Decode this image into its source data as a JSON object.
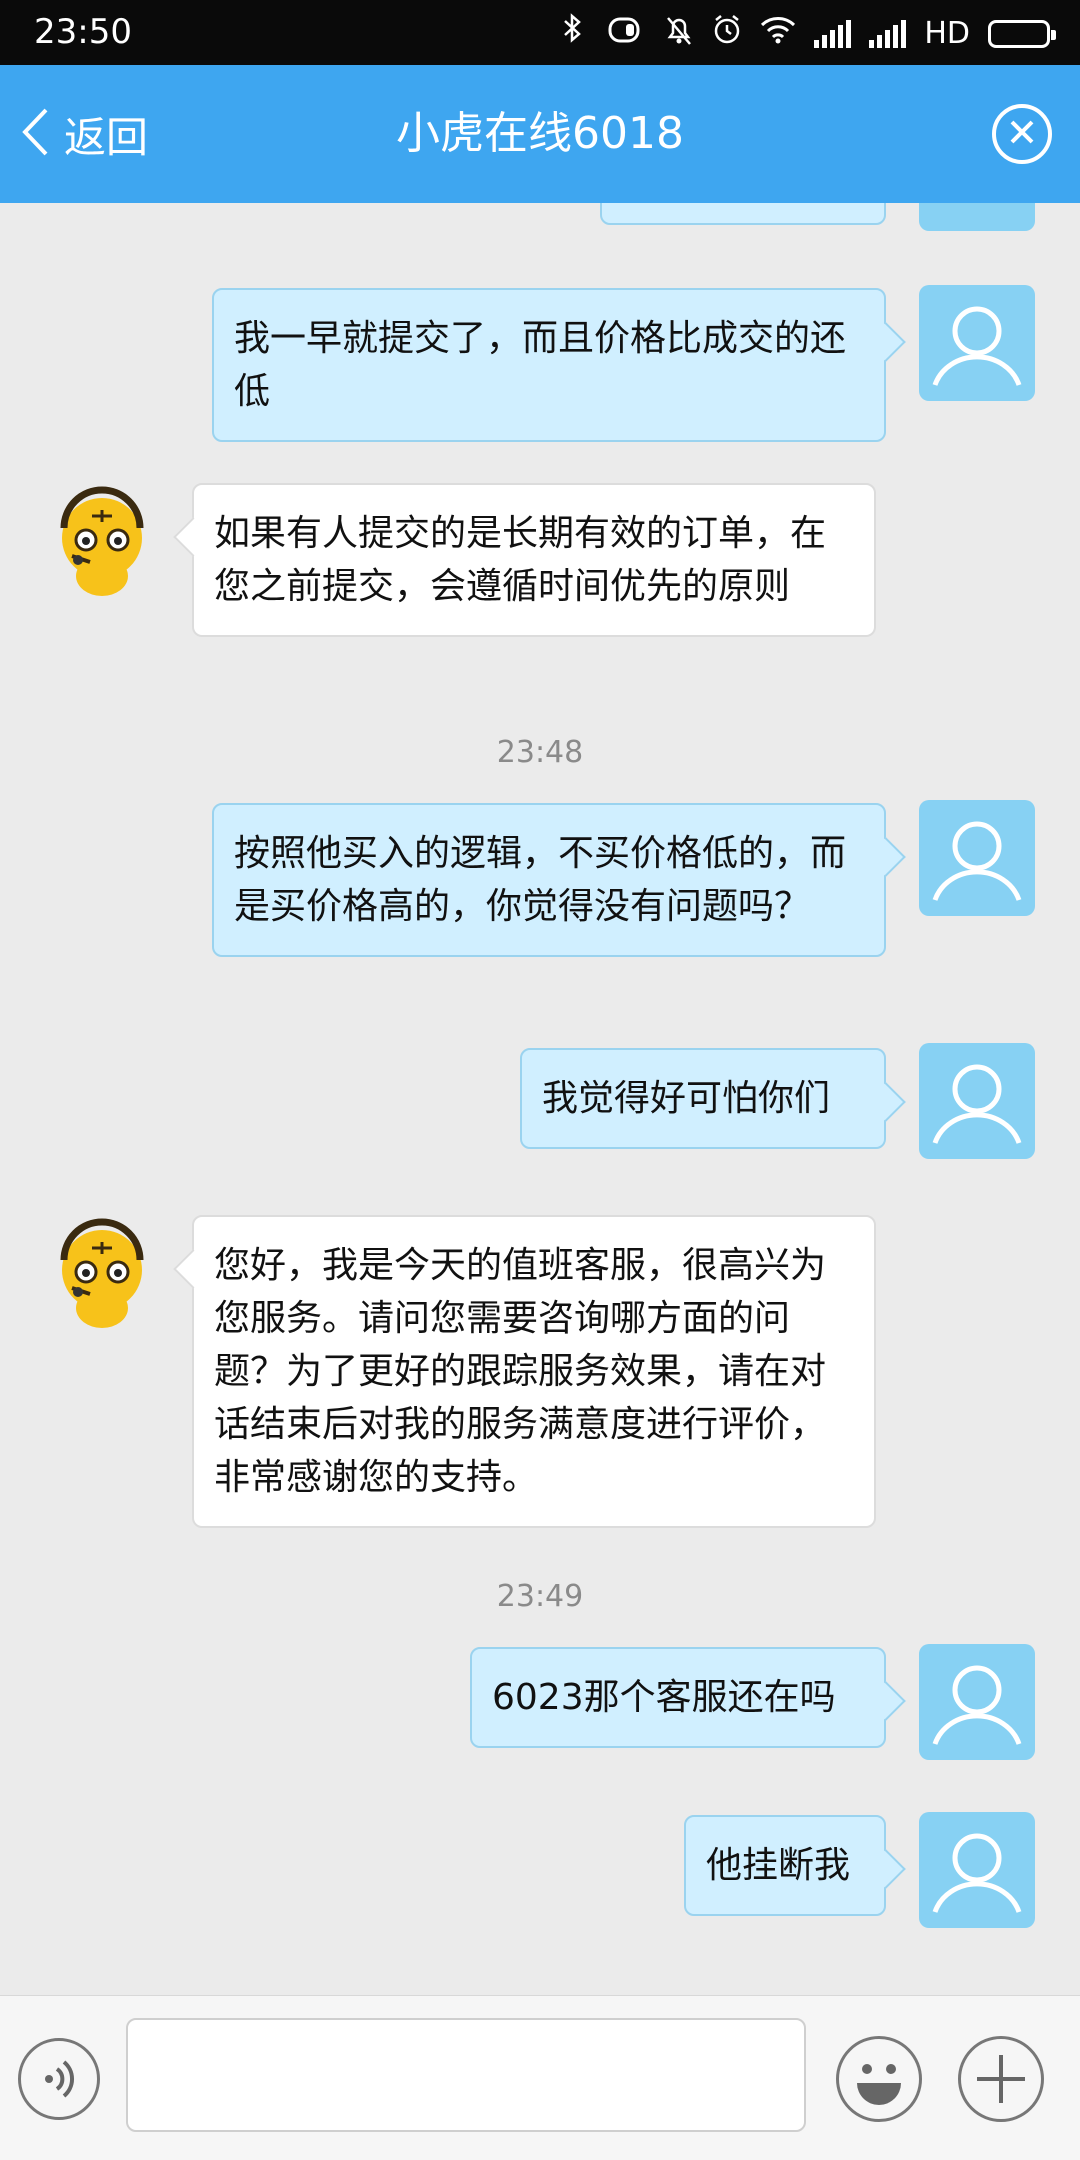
{
  "status_bar": {
    "time": "23:50",
    "network_label": "HD"
  },
  "header": {
    "back_label": "返回",
    "title": "小虎在线6018"
  },
  "messages": [
    {
      "sender": "user",
      "text": "我一早就提交了，而且价格比成交的还低"
    },
    {
      "sender": "agent",
      "text": "如果有人提交的是长期有效的订单，在您之前提交，会遵循时间优先的原则"
    },
    {
      "timestamp": "23:48"
    },
    {
      "sender": "user",
      "text": "按照他买入的逻辑，不买价格低的，而是买价格高的，你觉得没有问题吗？"
    },
    {
      "sender": "user",
      "text": "我觉得好可怕你们"
    },
    {
      "sender": "agent",
      "text": "您好，我是今天的值班客服，很高兴为您服务。请问您需要咨询哪方面的问题？为了更好的跟踪服务效果，请在对话结束后对我的服务满意度进行评价，非常感谢您的支持。"
    },
    {
      "timestamp": "23:49"
    },
    {
      "sender": "user",
      "text": "6023那个客服还在吗"
    },
    {
      "sender": "user",
      "text": "他挂断我"
    }
  ],
  "input": {
    "value": "",
    "placeholder": ""
  },
  "colors": {
    "header": "#3ea6f0",
    "user_bubble": "#d0efff",
    "user_avatar": "#87d1f3",
    "agent_bubble": "#ffffff",
    "background": "#ebebeb"
  }
}
